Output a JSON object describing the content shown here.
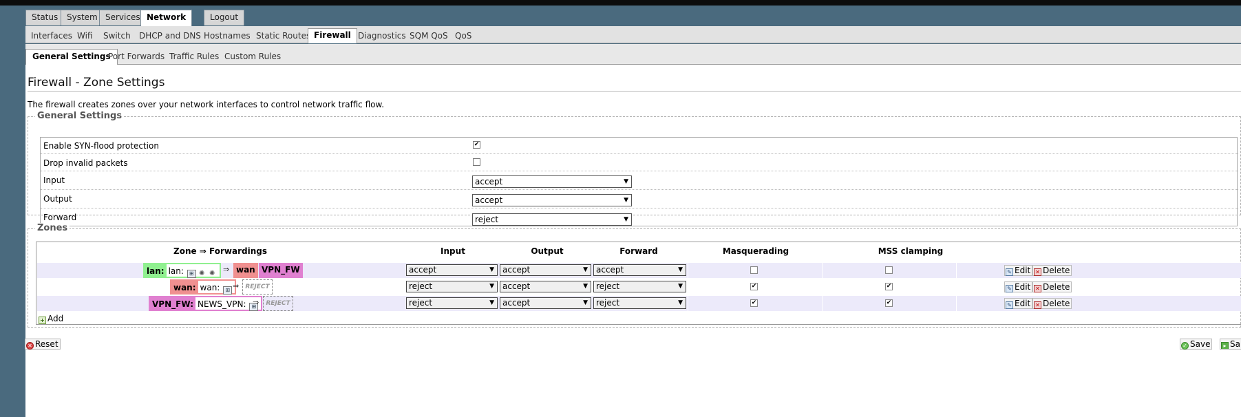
{
  "top_tabs": [
    "Status",
    "System",
    "Services",
    "Network",
    "Logout"
  ],
  "sub_tabs": [
    "Interfaces",
    "Wifi",
    "Switch",
    "DHCP and DNS",
    "Hostnames",
    "Static Routes",
    "Firewall",
    "Diagnostics",
    "SQM QoS",
    "QoS"
  ],
  "fw_tabs": [
    "General Settings",
    "Port Forwards",
    "Traffic Rules",
    "Custom Rules"
  ],
  "page": {
    "title": "Firewall - Zone Settings",
    "description": "The firewall creates zones over your network interfaces to control network traffic flow."
  },
  "general": {
    "legend": "General Settings",
    "syn_label": "Enable SYN-flood protection",
    "syn_checked": true,
    "drop_label": "Drop invalid packets",
    "drop_checked": false,
    "input_label": "Input",
    "input_value": "accept",
    "output_label": "Output",
    "output_value": "accept",
    "forward_label": "Forward",
    "forward_value": "reject"
  },
  "zones": {
    "legend": "Zones",
    "headers": {
      "zone": "Zone ⇒ Forwardings",
      "input": "Input",
      "output": "Output",
      "forward": "Forward",
      "masq": "Masquerading",
      "mss": "MSS clamping"
    },
    "rows": [
      {
        "name": "lan:",
        "ifaces": "lan:",
        "color": "#90f090",
        "targets": [
          "wan",
          "VPN_FW"
        ],
        "input": "accept",
        "output": "accept",
        "forward": "accept",
        "masq": false,
        "mss": false
      },
      {
        "name": "wan:",
        "ifaces": "wan:",
        "color": "#f09090",
        "reject": "REJECT",
        "input": "reject",
        "output": "accept",
        "forward": "reject",
        "masq": true,
        "mss": true
      },
      {
        "name": "VPN_FW:",
        "ifaces": "NEWS_VPN:",
        "color": "#e080d0",
        "reject": "REJECT",
        "input": "reject",
        "output": "accept",
        "forward": "reject",
        "masq": true,
        "mss": true
      }
    ],
    "edit_label": "Edit",
    "delete_label": "Delete",
    "add_label": "Add"
  },
  "footer": {
    "reset_label": "Reset",
    "save_label": "Save",
    "apply_label": "Sa"
  }
}
